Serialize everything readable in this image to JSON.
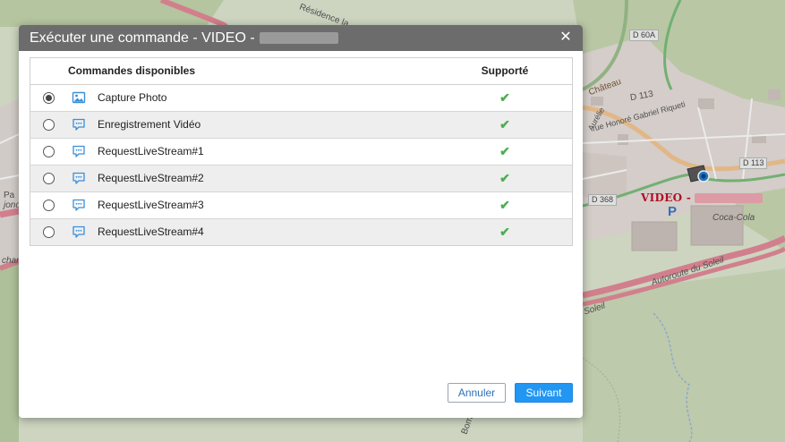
{
  "map": {
    "labels": [
      "Résidence la",
      "D 60A",
      "Château",
      "D 113",
      "rue Honoré Gabriel Riqueti",
      "Aurélie",
      "D 368",
      "Coca-Cola",
      "Autoroute du Soleil",
      "Soleil",
      "D 113",
      "Pa",
      "jonq",
      "char",
      "Bom"
    ],
    "vehicle_label": "VIDEO -",
    "parking_symbol": "P",
    "colors": {
      "land": "#dfe8d2",
      "forest": "#b9cf9f",
      "urban": "#e6dfdb",
      "motorway": "#e48a9a",
      "primary": "#f5c793"
    }
  },
  "dialog": {
    "title": "Exécuter une commande - VIDEO -",
    "close_symbol": "✕",
    "table": {
      "headers": {
        "name": "Commandes disponibles",
        "supported": "Supporté"
      },
      "rows": [
        {
          "label": "Capture Photo",
          "icon": "image-icon",
          "selected": true,
          "supported": "✔"
        },
        {
          "label": "Enregistrement Vidéo",
          "icon": "chat-bubble-icon",
          "selected": false,
          "supported": "✔"
        },
        {
          "label": "RequestLiveStream#1",
          "icon": "chat-bubble-icon",
          "selected": false,
          "supported": "✔"
        },
        {
          "label": "RequestLiveStream#2",
          "icon": "chat-bubble-icon",
          "selected": false,
          "supported": "✔"
        },
        {
          "label": "RequestLiveStream#3",
          "icon": "chat-bubble-icon",
          "selected": false,
          "supported": "✔"
        },
        {
          "label": "RequestLiveStream#4",
          "icon": "chat-bubble-icon",
          "selected": false,
          "supported": "✔"
        }
      ]
    },
    "buttons": {
      "cancel": "Annuler",
      "next": "Suivant"
    },
    "colors": {
      "header_bg": "#6c6c6c",
      "check": "#4caf50",
      "primary": "#2196f3",
      "icon": "#3a8fd8"
    }
  }
}
